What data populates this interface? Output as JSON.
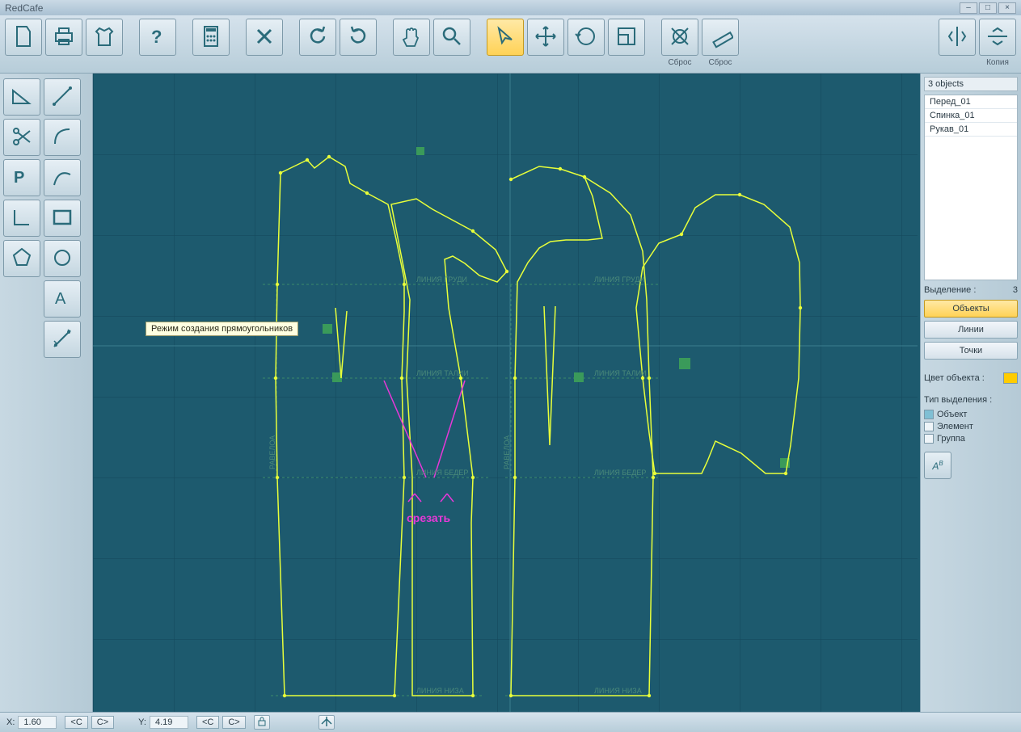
{
  "app": {
    "title": "RedCafe"
  },
  "toolbar": {
    "reset1": "Сброс",
    "reset2": "Сброс",
    "copy": "Копия"
  },
  "tooltip": "Режим создания прямоугольников",
  "canvas": {
    "label_chest1": "ЛИНИЯ  ГРУДИ",
    "label_chest2": "ЛИНИЯ  ГРУДИ",
    "label_waist1": "ЛИНИЯ  ТАЛИИ",
    "label_waist2": "ЛИНИЯ  ТАЛИИ",
    "label_hip1": "ЛИНИЯ  БЕДЕР",
    "label_hip2": "ЛИНИЯ  БЕДЕР",
    "label_bottom1": "ЛИНИЯ  НИЗА",
    "label_bottom2": "ЛИНИЯ  НИЗА",
    "label_balance1": "РАВЕЛОА",
    "label_balance2": "РАВЕЛОА",
    "cut_text": "срезать"
  },
  "right": {
    "header": "3 objects",
    "items": [
      "Перед_01",
      "Спинка_01",
      "Рукав_01"
    ],
    "selection_label": "Выделение :",
    "selection_count": "3",
    "btn_objects": "Объекты",
    "btn_lines": "Линии",
    "btn_points": "Точки",
    "color_label": "Цвет объекта :",
    "seltype_label": "Тип выделения :",
    "chk_object": "Объект",
    "chk_element": "Элемент",
    "chk_group": "Группа"
  },
  "status": {
    "x_label": "X:",
    "x_val": "1.60",
    "y_label": "Y:",
    "y_val": "4.19",
    "lt": "<C",
    "gt": "C>"
  }
}
